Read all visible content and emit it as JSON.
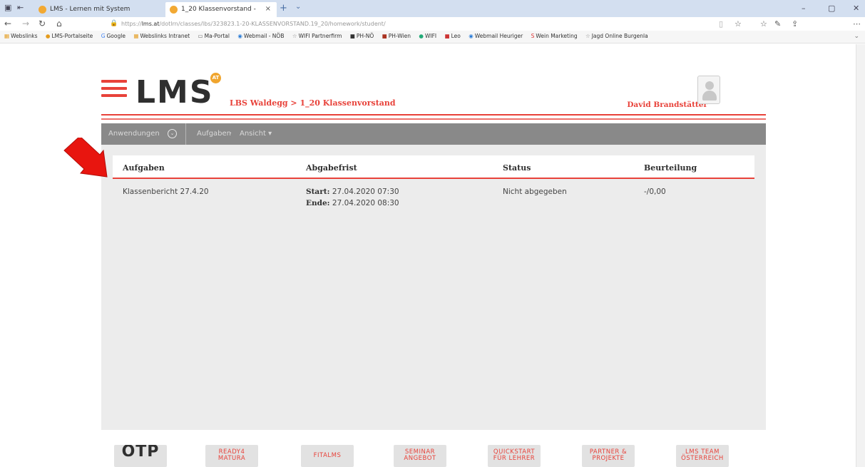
{
  "browser": {
    "tabs": [
      {
        "label": "LMS - Lernen mit System"
      },
      {
        "label": "1_20 Klassenvorstand -"
      }
    ],
    "tab_close": "×",
    "new_tab": "+",
    "tab_dropdown": "⌄",
    "url_prefix": "https://",
    "url_host": "lms.at",
    "url_path": "/dotlrn/classes/lbs/323823.1-20-KLASSENVORSTAND.19_20/homework/student/",
    "favorites": [
      "Webslinks",
      "LMS-Portalseite",
      "Google",
      "Webslinks Intranet",
      "Ma-Portal",
      "Webmail - NÖB",
      "WIFI Partnerfirm",
      "PH-NÖ",
      "PH-Wien",
      "WIFI",
      "Leo",
      "Webmail Heuriger",
      "Wein Marketing",
      "Jagd Online Burgenla"
    ],
    "window_controls": [
      "–",
      "▢",
      "✕"
    ]
  },
  "header": {
    "logo": "LMS",
    "logo_badge": "AT",
    "breadcrumb": "LBS Waldegg > 1_20 Klassenvorstand",
    "user_name": "David Brandstätter"
  },
  "toolbar": {
    "applications": "Anwendungen",
    "applications_toggle": "⊙",
    "tasks": "Aufgaben",
    "sep": "·",
    "view": "Ansicht ▾"
  },
  "table": {
    "columns": [
      "Aufgaben",
      "Abgabefrist",
      "Status",
      "Beurteilung"
    ],
    "rows": [
      {
        "task": "Klassenbericht 27.4.20",
        "start_label": "Start:",
        "start": "27.04.2020 07:30",
        "end_label": "Ende:",
        "end": "27.04.2020 08:30",
        "status": "Nicht abgegeben",
        "grade": "-/0,00"
      }
    ]
  },
  "footer": {
    "buttons": [
      {
        "label": "OTP"
      },
      {
        "label": "READY4 MATURA"
      },
      {
        "label": "FITALMS"
      },
      {
        "label": "SEMINAR ANGEBOT"
      },
      {
        "label": "QUICKSTART FÜR LEHRER"
      },
      {
        "label": "PARTNER & PROJEKTE"
      },
      {
        "label": "LMS TEAM ÖSTERREICH"
      }
    ]
  },
  "colors": {
    "accent": "#e8423a",
    "toolbar_bg": "#898989",
    "content_bg": "#ececec",
    "annotation_arrow": "#e8150f"
  }
}
